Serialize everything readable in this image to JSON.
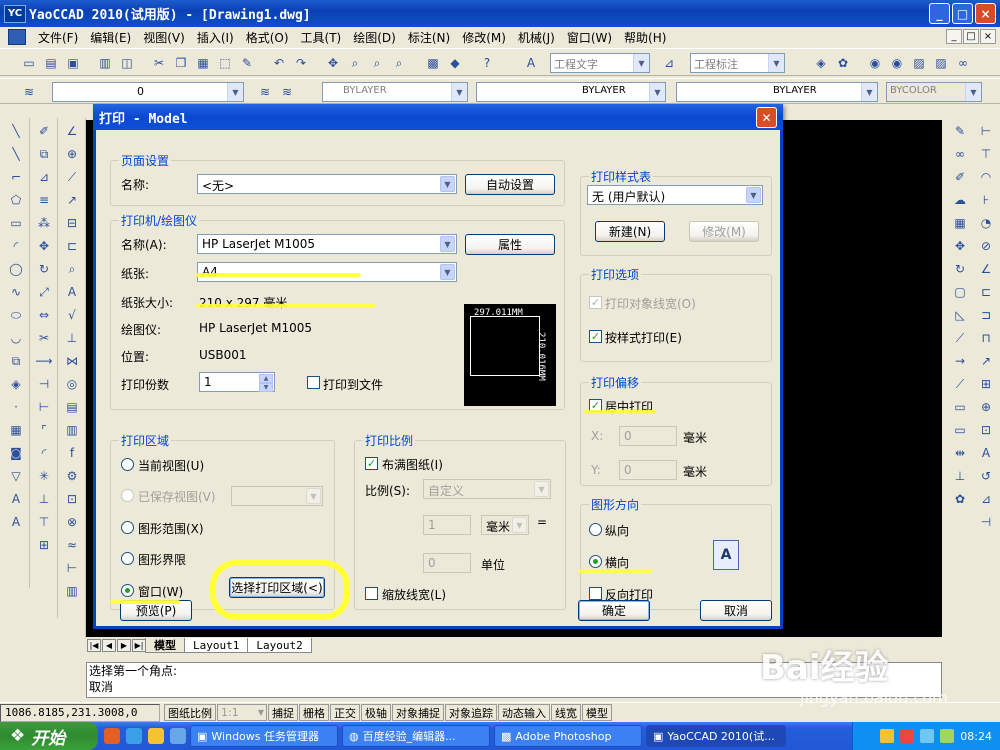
{
  "app": {
    "logo": "YC",
    "title": "YaoCCAD 2010(试用版) - [Drawing1.dwg]",
    "win_buttons": [
      "_",
      "□",
      "×"
    ],
    "mdi_buttons": [
      "_",
      "□",
      "×"
    ]
  },
  "menubar": {
    "items": [
      "文件(F)",
      "编辑(E)",
      "视图(V)",
      "插入(I)",
      "格式(O)",
      "工具(T)",
      "绘图(D)",
      "标注(N)",
      "修改(M)",
      "机械(J)",
      "窗口(W)",
      "帮助(H)"
    ]
  },
  "toolbar": {
    "text_style": "工程文字",
    "dim_style": "工程标注",
    "layer": "0",
    "color": "BYLAYER",
    "linetype": "BYLAYER",
    "lineweight": "BYLAYER",
    "plotstyle": "BYCOLOR"
  },
  "dialog": {
    "title": "打印 - Model",
    "page_setup": {
      "group": "页面设置",
      "name_label": "名称:",
      "name_value": "<无>",
      "auto_button": "自动设置"
    },
    "printer": {
      "group": "打印机/绘图仪",
      "name_label": "名称(A):",
      "name_value": "HP LaserJet M1005",
      "props_button": "属性",
      "paper_label": "纸张:",
      "paper_value": "A4",
      "size_label": "纸张大小:",
      "size_value": "210 x 297 毫米",
      "plotter_label": "绘图仪:",
      "plotter_value": "HP LaserJet M1005",
      "where_label": "位置:",
      "where_value": "USB001",
      "copies_label": "打印份数",
      "copies_value": "1",
      "to_file": "打印到文件",
      "preview_w": "297.011MM",
      "preview_h": "210.016MM"
    },
    "area": {
      "group": "打印区域",
      "options": [
        "当前视图(U)",
        "已保存视图(V)",
        "图形范围(X)",
        "图形界限",
        "窗口(W)"
      ],
      "select_button": "选择打印区域(<)"
    },
    "scale": {
      "group": "打印比例",
      "fit": "布满图纸(I)",
      "ratio_label": "比例(S):",
      "ratio_value": "自定义",
      "value1": "1",
      "unit_value": "毫米",
      "equals": "=",
      "value2": "0",
      "unit2": "单位",
      "lineweights": "缩放线宽(L)"
    },
    "style_table": {
      "group": "打印样式表",
      "value": "无 (用户默认)",
      "new_button": "新建(N)",
      "edit_button": "修改(M)"
    },
    "options": {
      "group": "打印选项",
      "obj_lineweights": "打印对象线宽(O)",
      "by_style": "按样式打印(E)"
    },
    "offset": {
      "group": "打印偏移",
      "center": "居中打印",
      "x_label": "X:",
      "x_value": "0",
      "x_unit": "毫米",
      "y_label": "Y:",
      "y_value": "0",
      "y_unit": "毫米"
    },
    "orientation": {
      "group": "图形方向",
      "portrait": "纵向",
      "landscape": "横向",
      "reverse": "反向打印",
      "icon": "A"
    },
    "buttons": {
      "preview": "预览(P)",
      "ok": "确定",
      "cancel": "取消"
    }
  },
  "layout_tabs": [
    "模型",
    "Layout1",
    "Layout2"
  ],
  "command": {
    "line1": "选择第一个角点:",
    "line2": "取消"
  },
  "status": {
    "coords": "1086.8185,231.3008,0",
    "scale_label": "图纸比例",
    "scale_value": "1:1",
    "toggles": [
      "捕捉",
      "栅格",
      "正交",
      "极轴",
      "对象捕捉",
      "对象追踪",
      "动态输入",
      "线宽",
      "模型"
    ]
  },
  "taskbar": {
    "start": "开始",
    "tasks": [
      "Windows 任务管理器",
      "百度经验_编辑器...",
      "Adobe Photoshop",
      "YaoCCAD 2010(试..."
    ],
    "time": "08:24"
  },
  "watermark": {
    "main": "Bai经验",
    "sub": "jingyan.baidu.com"
  },
  "colors": {
    "highlight": "#ffff33",
    "titlebar": "#0a49cf",
    "group_title": "#0046d5",
    "check_green": "#21a121"
  }
}
